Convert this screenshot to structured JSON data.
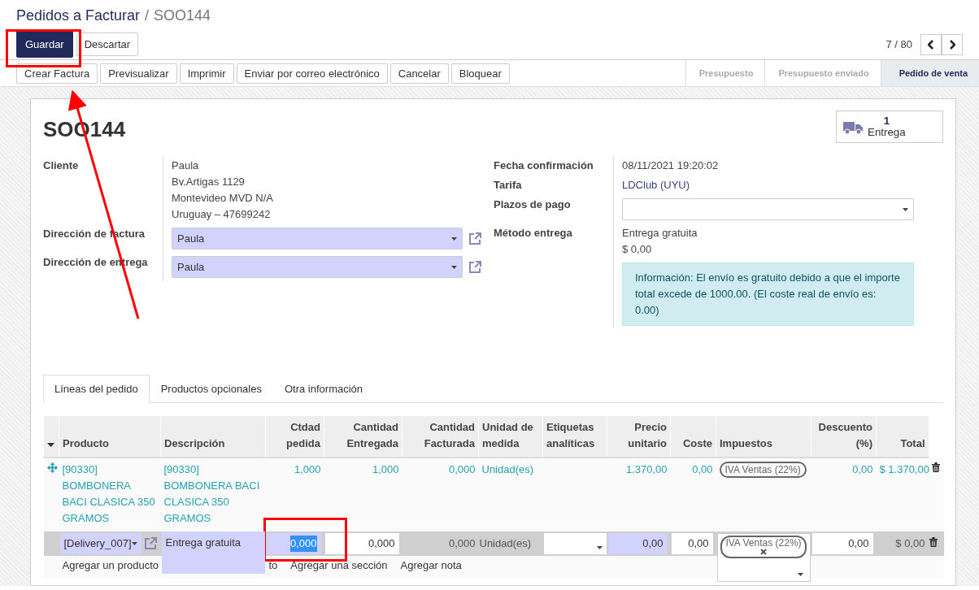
{
  "breadcrumb": [
    {
      "label": "Pedidos a Facturar",
      "kind": "link"
    },
    {
      "label": "SOO144",
      "kind": "current"
    }
  ],
  "breadcrumb_separator": "/",
  "control_buttons": [
    {
      "label": "Guardar",
      "kind": "primary"
    },
    {
      "label": "Descartar",
      "kind": "secondary"
    }
  ],
  "pager": {
    "value": "7 / 80"
  },
  "action_buttons": [
    "Crear Factura",
    "Previsualizar",
    "Imprimir",
    "Enviar por correo electrónico",
    "Cancelar",
    "Bloquear"
  ],
  "status_steps": [
    {
      "label": "Presupuesto",
      "selected": false
    },
    {
      "label": "Presupuesto enviado",
      "selected": false
    },
    {
      "label": "Pedido de venta",
      "selected": true
    }
  ],
  "record": {
    "name": "SOO144",
    "stat_button": {
      "count": "1",
      "label": "Entrega"
    }
  },
  "left_fields": [
    {
      "label": "Cliente",
      "kind": "text",
      "lines": [
        "Paula",
        "Bv.Artigas 1129",
        "Montevideo MVD N/A",
        "Uruguay – 47699242"
      ]
    },
    {
      "label": "Dirección de factura",
      "kind": "select",
      "value": "Paula",
      "required": true
    },
    {
      "label": "Dirección de entrega",
      "kind": "select",
      "value": "Paula",
      "required": true
    }
  ],
  "right_fields": [
    {
      "label": "Fecha confirmación",
      "kind": "text",
      "lines": [
        "08/11/2021 19:20:02"
      ]
    },
    {
      "label": "Tarifa",
      "kind": "link",
      "lines": [
        "LDClub (UYU)"
      ]
    },
    {
      "label": "Plazos de pago",
      "kind": "select",
      "required": false
    },
    {
      "label": "Método entrega",
      "kind": "text",
      "lines": [
        "Entrega gratuita",
        "$ 0,00"
      ]
    }
  ],
  "info_alert": "Información: El envío es gratuito debido a que el importe total excede de 1000.00. (El coste real de envío es: 0.00)",
  "tabs": [
    {
      "label": "Líneas del pedido",
      "selected": true
    },
    {
      "label": "Productos opcionales",
      "selected": false
    },
    {
      "label": "Otra información",
      "selected": false
    }
  ],
  "table": {
    "columns": [
      {
        "label": "Producto",
        "kind": "text"
      },
      {
        "label": "Descripción",
        "kind": "text"
      },
      {
        "label": "Ctdad pedida",
        "kind": "number"
      },
      {
        "label": "Cantidad Entregada",
        "kind": "number"
      },
      {
        "label": "Cantidad Facturada",
        "kind": "number"
      },
      {
        "label": "Unidad de medida",
        "kind": "text"
      },
      {
        "label": "Etiquetas analíticas",
        "kind": "text"
      },
      {
        "label": "Precio unitario",
        "kind": "number"
      },
      {
        "label": "Coste",
        "kind": "number"
      },
      {
        "label": "Impuestos",
        "kind": "text"
      },
      {
        "label": "Descuento (%)",
        "kind": "number"
      },
      {
        "label": "Total",
        "kind": "number"
      }
    ],
    "rows": [
      {
        "kind": "info",
        "cells": [
          {
            "kind": "text",
            "text": "[90330] BOMBONERA BACI CLASICA 350 GRAMOS"
          },
          {
            "kind": "text",
            "text": "[90330] BOMBONERA BACI CLASICA 350 GRAMOS"
          },
          {
            "kind": "text",
            "text": "1,000"
          },
          {
            "kind": "text",
            "text": "1,000"
          },
          {
            "kind": "text",
            "text": "0,000"
          },
          {
            "kind": "text",
            "text": "Unidad(es)"
          },
          {
            "kind": "text"
          },
          {
            "kind": "text",
            "text": "1.370,00"
          },
          {
            "kind": "text",
            "text": "0,00"
          },
          {
            "kind": "tags",
            "tags": [
              "IVA Ventas (22%)"
            ]
          },
          {
            "kind": "text",
            "text": "0,00"
          },
          {
            "kind": "text",
            "text": "$ 1.370,00"
          }
        ]
      },
      {
        "kind": "editing",
        "cells": [
          {
            "kind": "select",
            "text": "[Delivery_007]",
            "required": true
          },
          {
            "kind": "textarea",
            "text": "Entrega gratuita",
            "required": true
          },
          {
            "kind": "input",
            "text": "0,000",
            "required": true,
            "text_selected": true
          },
          {
            "kind": "input",
            "text": "0,000",
            "required": false
          },
          {
            "kind": "text",
            "text": "0,000"
          },
          {
            "kind": "text",
            "text": "Unidad(es)"
          },
          {
            "kind": "select",
            "required": false
          },
          {
            "kind": "input",
            "text": "0,00",
            "required": true
          },
          {
            "kind": "input",
            "text": "0,00",
            "required": false
          },
          {
            "kind": "tags",
            "tags": [
              "IVA Ventas (22%)"
            ]
          },
          {
            "kind": "input",
            "text": "0,00",
            "required": false
          },
          {
            "kind": "text",
            "text": "$ 0,00"
          }
        ]
      }
    ],
    "add_links": [
      "Agregar un producto",
      "to",
      "Agregar una sección",
      "Agregar nota"
    ]
  }
}
